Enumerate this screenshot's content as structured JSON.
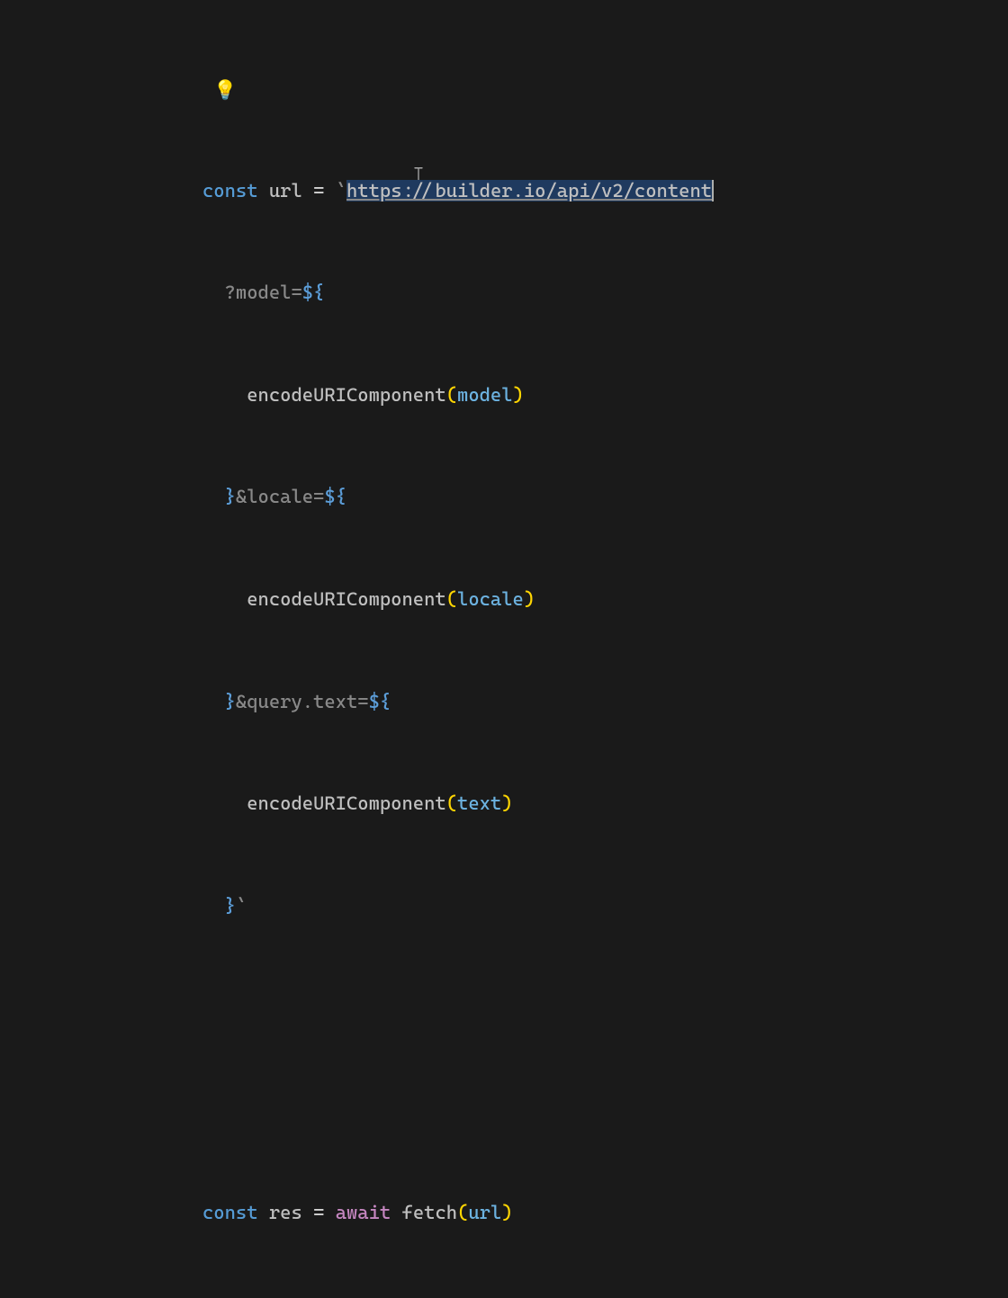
{
  "editor": {
    "lightbulb": "💡",
    "line1": {
      "keyword": "const",
      "ident": "url",
      "eq": " = ",
      "backtick": "`",
      "url": "https://builder.io/api/v2/content"
    },
    "line2": {
      "indent": "  ",
      "query": "?model=",
      "tmpl_open": "${"
    },
    "line3": {
      "indent": "    ",
      "func": "encodeURIComponent",
      "lparen": "(",
      "param": "model",
      "rparen": ")"
    },
    "line4": {
      "indent": "  ",
      "tmpl_close": "}",
      "query": "&locale=",
      "tmpl_open": "${"
    },
    "line5": {
      "indent": "    ",
      "func": "encodeURIComponent",
      "lparen": "(",
      "param": "locale",
      "rparen": ")"
    },
    "line6": {
      "indent": "  ",
      "tmpl_close": "}",
      "query": "&query.text=",
      "tmpl_open": "${"
    },
    "line7": {
      "indent": "    ",
      "func": "encodeURIComponent",
      "lparen": "(",
      "param": "text",
      "rparen": ")"
    },
    "line8": {
      "indent": "  ",
      "tmpl_close": "}",
      "backtick": "`"
    },
    "line9": {
      "keyword": "const",
      "ident": "res",
      "eq": " = ",
      "await": "await",
      "space": " ",
      "func": "fetch",
      "lparen": "(",
      "param": "url",
      "rparen": ")"
    }
  }
}
